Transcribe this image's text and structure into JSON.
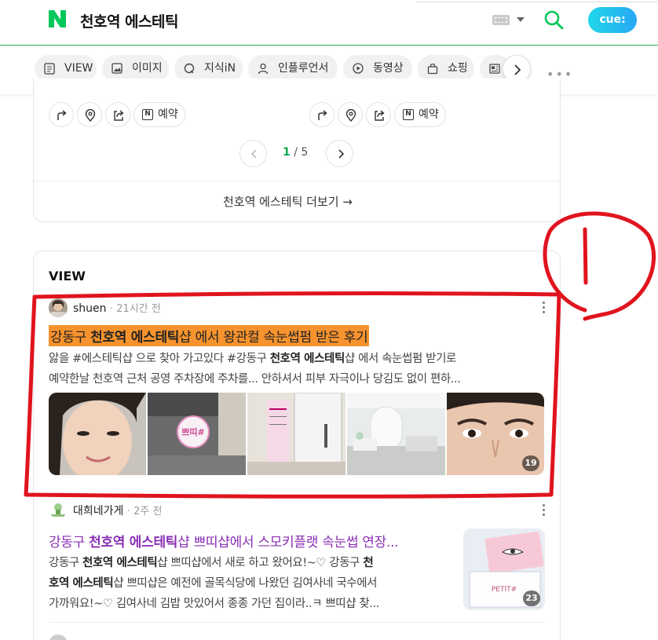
{
  "header": {
    "query": "천호역 에스테틱",
    "cue_label": "cue:"
  },
  "tabs": [
    {
      "label": "VIEW",
      "icon": "document-icon"
    },
    {
      "label": "이미지",
      "icon": "image-icon"
    },
    {
      "label": "지식iN",
      "icon": "q-icon"
    },
    {
      "label": "인플루언서",
      "icon": "person-icon"
    },
    {
      "label": "동영상",
      "icon": "play-icon"
    },
    {
      "label": "쇼핑",
      "icon": "bag-icon"
    }
  ],
  "place_card": {
    "reserve_label": "예약",
    "page_current": "1",
    "page_sep": " / ",
    "page_total": "5",
    "more_link": "천호역 에스테틱 더보기 →"
  },
  "view_section": {
    "title": "VIEW",
    "posts": [
      {
        "author": "shuen",
        "time": "· 21시간 전",
        "title_pre": "강동구 ",
        "title_bold": "천호역 에스테틱",
        "title_post": "샵 에서 왕관컬 속눈썹펌 받은 후기",
        "desc1_pre": "앓을 #에스테틱샵 으로 찾아 가고있다 #강동구 ",
        "desc1_bold": "천호역 에스테틱",
        "desc1_post": "샵 에서 속눈썹펌 받기로",
        "desc2": "예약한날 천호역 근처 공영 주차장에 주차를... 안하셔서 피부 자극이나 당김도 없이 편하...",
        "image_count": "19",
        "sign_text": "쁘띠#"
      },
      {
        "author": "대희네가게",
        "time": "· 2주 전",
        "title_pre": "강동구 ",
        "title_bold": "천호역 에스테틱",
        "title_post": "샵 쁘띠샵에서 스모키플랫 속눈썹 연장...",
        "desc1_pre": "강동구 ",
        "desc1_bold": "천호역 에스테틱",
        "desc1_post": "샵 쁘띠샵에서 새로 하고 왔어요!~♡ 강동구 ",
        "desc1_bold2": "천",
        "desc2_bold": "호역 에스테틱",
        "desc2_post": "샵 쁘띠샵은 예전에 골목식당에 나왔던 김여사네 국수에서",
        "desc3": "가까워요!~♡ 김여사네 김밥 맛있어서 종종 가던 집이라..ㅋ 쁘띠샵 찾...",
        "image_count": "23",
        "thumb_brand": "PETIT#"
      }
    ]
  },
  "colors": {
    "brand_green": "#03c75a",
    "highlight_orange": "#f7932e",
    "visited_title": "#8a2fb4",
    "annotation_red": "#e0141e"
  }
}
